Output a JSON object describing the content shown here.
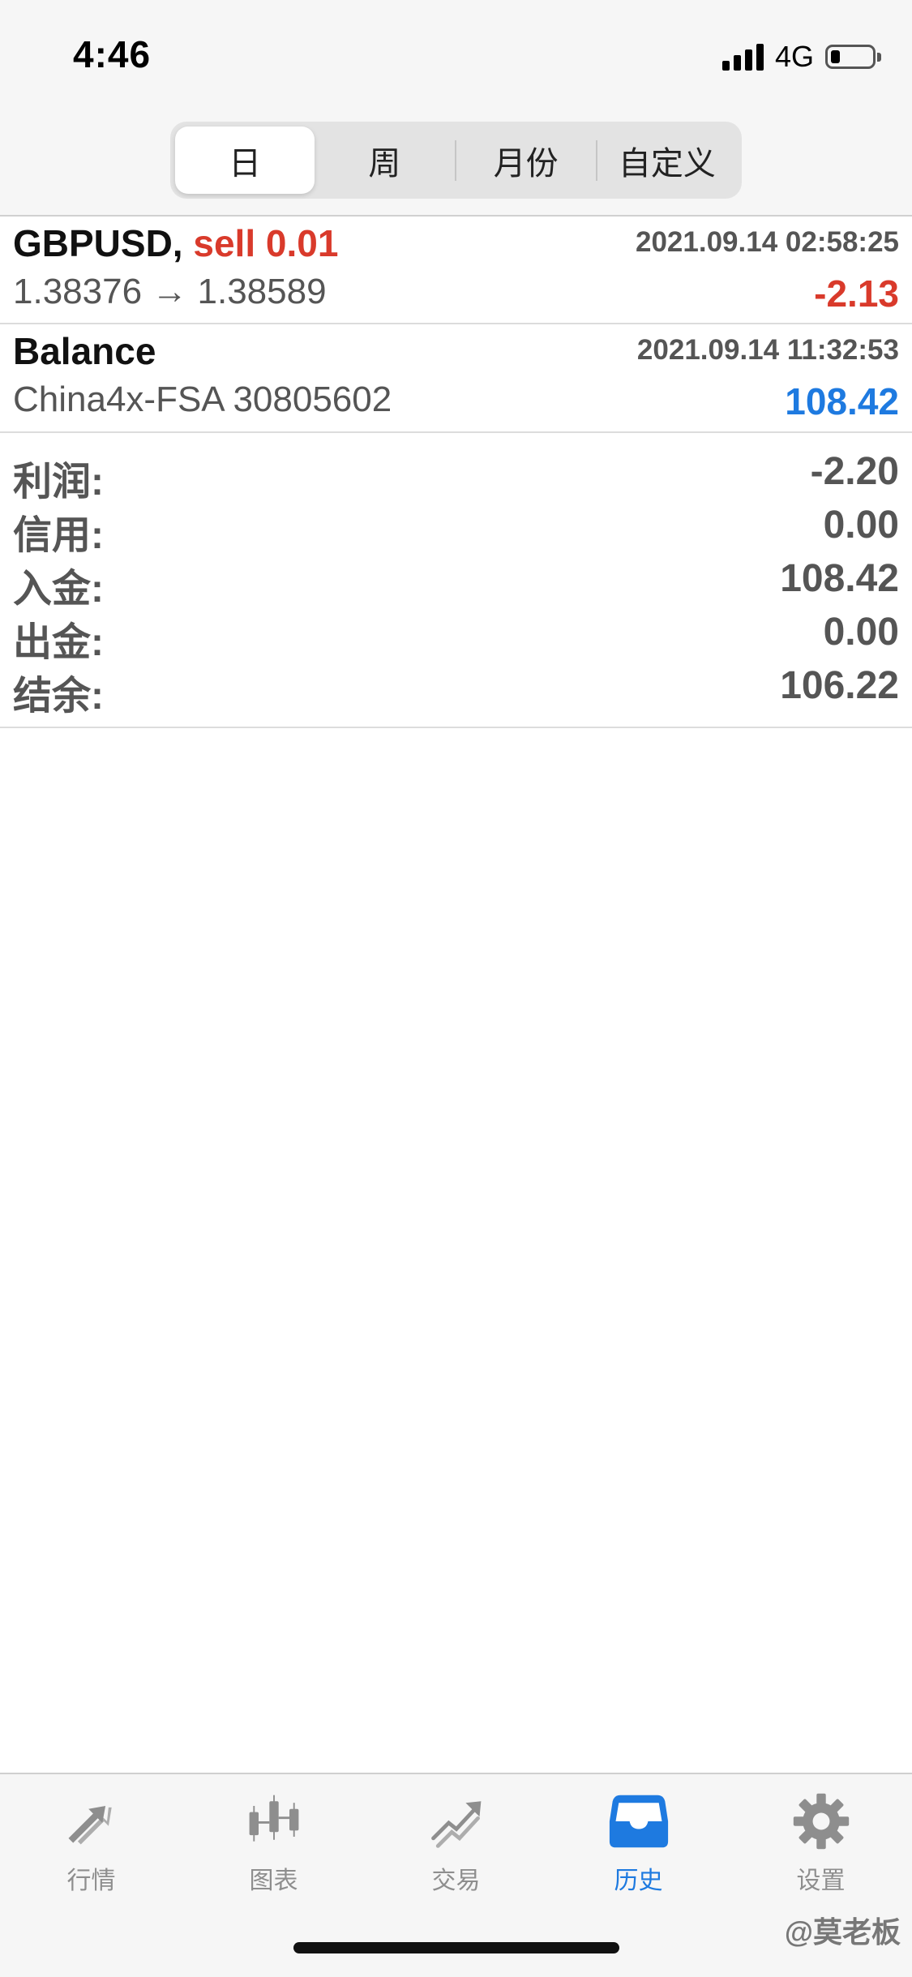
{
  "status_bar": {
    "time": "4:46",
    "network": "4G"
  },
  "segmented_control": {
    "tabs": [
      "日",
      "周",
      "月份",
      "自定义"
    ],
    "selected": "日"
  },
  "history": [
    {
      "symbol": "GBPUSD,",
      "side": "sell 0.01",
      "timestamp": "2021.09.14 02:58:25",
      "prices": "1.38376 → 1.38589",
      "amount": "-2.13",
      "amount_color": "#d93a2b"
    },
    {
      "symbol": "Balance",
      "timestamp": "2021.09.14 11:32:53",
      "account": "China4x-FSA 30805602",
      "amount": "108.42",
      "amount_color": "#1e7ae0"
    }
  ],
  "summary": {
    "profit_label": "利润:",
    "profit": "-2.20",
    "credit_label": "信用:",
    "credit": "0.00",
    "deposit_label": "入金:",
    "deposit": "108.42",
    "withdrawal_label": "出金:",
    "withdrawal": "0.00",
    "balance_label": "结余:",
    "balance": "106.22"
  },
  "tab_bar": {
    "items": [
      {
        "label": "行情",
        "icon": "quotes-arrows-icon"
      },
      {
        "label": "图表",
        "icon": "candlestick-chart-icon"
      },
      {
        "label": "交易",
        "icon": "trade-trend-icon"
      },
      {
        "label": "历史",
        "icon": "history-inbox-icon"
      },
      {
        "label": "设置",
        "icon": "gear-icon"
      }
    ],
    "active": "历史",
    "active_color": "#1e7ae0",
    "inactive_color": "#8e8e8e"
  },
  "watermark": "@莫老板"
}
